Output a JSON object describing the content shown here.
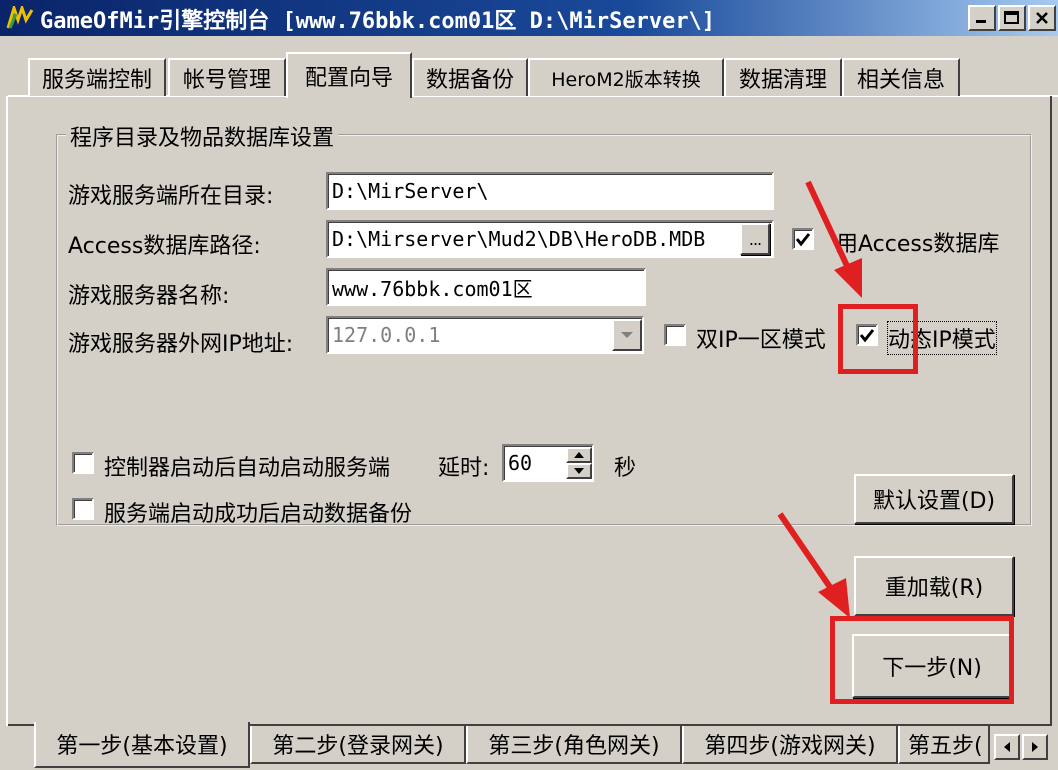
{
  "window": {
    "title": "GameOfMir引擎控制台 [www.76bbk.com01区 D:\\MirServer\\]",
    "min_icon": "minimize-icon",
    "max_icon": "maximize-icon",
    "close_icon": "close-icon"
  },
  "top_tabs": [
    {
      "label": "服务端控制"
    },
    {
      "label": "帐号管理"
    },
    {
      "label": "配置向导"
    },
    {
      "label": "数据备份"
    },
    {
      "label": "HeroM2版本转换"
    },
    {
      "label": "数据清理"
    },
    {
      "label": "相关信息"
    }
  ],
  "group": {
    "legend": "程序目录及物品数据库设置",
    "server_dir_label": "游戏服务端所在目录:",
    "server_dir_value": "D:\\MirServer\\",
    "access_path_label": "Access数据库路径:",
    "access_path_value": "D:\\Mirserver\\Mud2\\DB\\HeroDB.MDB",
    "browse_label": "...",
    "use_access_label": "用Access数据库",
    "use_access_checked": true,
    "server_name_label": "游戏服务器名称:",
    "server_name_value": "www.76bbk.com01区",
    "wan_ip_label": "游戏服务器外网IP地址:",
    "wan_ip_value": "127.0.0.1",
    "dual_ip_label": "双IP一区模式",
    "dual_ip_checked": false,
    "dynamic_ip_label": "动态IP模式",
    "dynamic_ip_checked": true
  },
  "options": {
    "auto_start_label": "控制器启动后自动启动服务端",
    "delay_label": "延时:",
    "delay_value": "60",
    "seconds_label": "秒",
    "auto_backup_label": "服务端启动成功后启动数据备份",
    "default_btn": "默认设置(D)",
    "reload_btn": "重加载(R)",
    "next_btn": "下一步(N)"
  },
  "bottom_tabs": [
    {
      "label": "第一步(基本设置)"
    },
    {
      "label": "第二步(登录网关)"
    },
    {
      "label": "第三步(角色网关)"
    },
    {
      "label": "第四步(游戏网关)"
    },
    {
      "label": "第五步("
    }
  ],
  "colors": {
    "titlebar": "#0a246a",
    "face": "#d4d0c8",
    "annotation_red": "#e02020"
  }
}
